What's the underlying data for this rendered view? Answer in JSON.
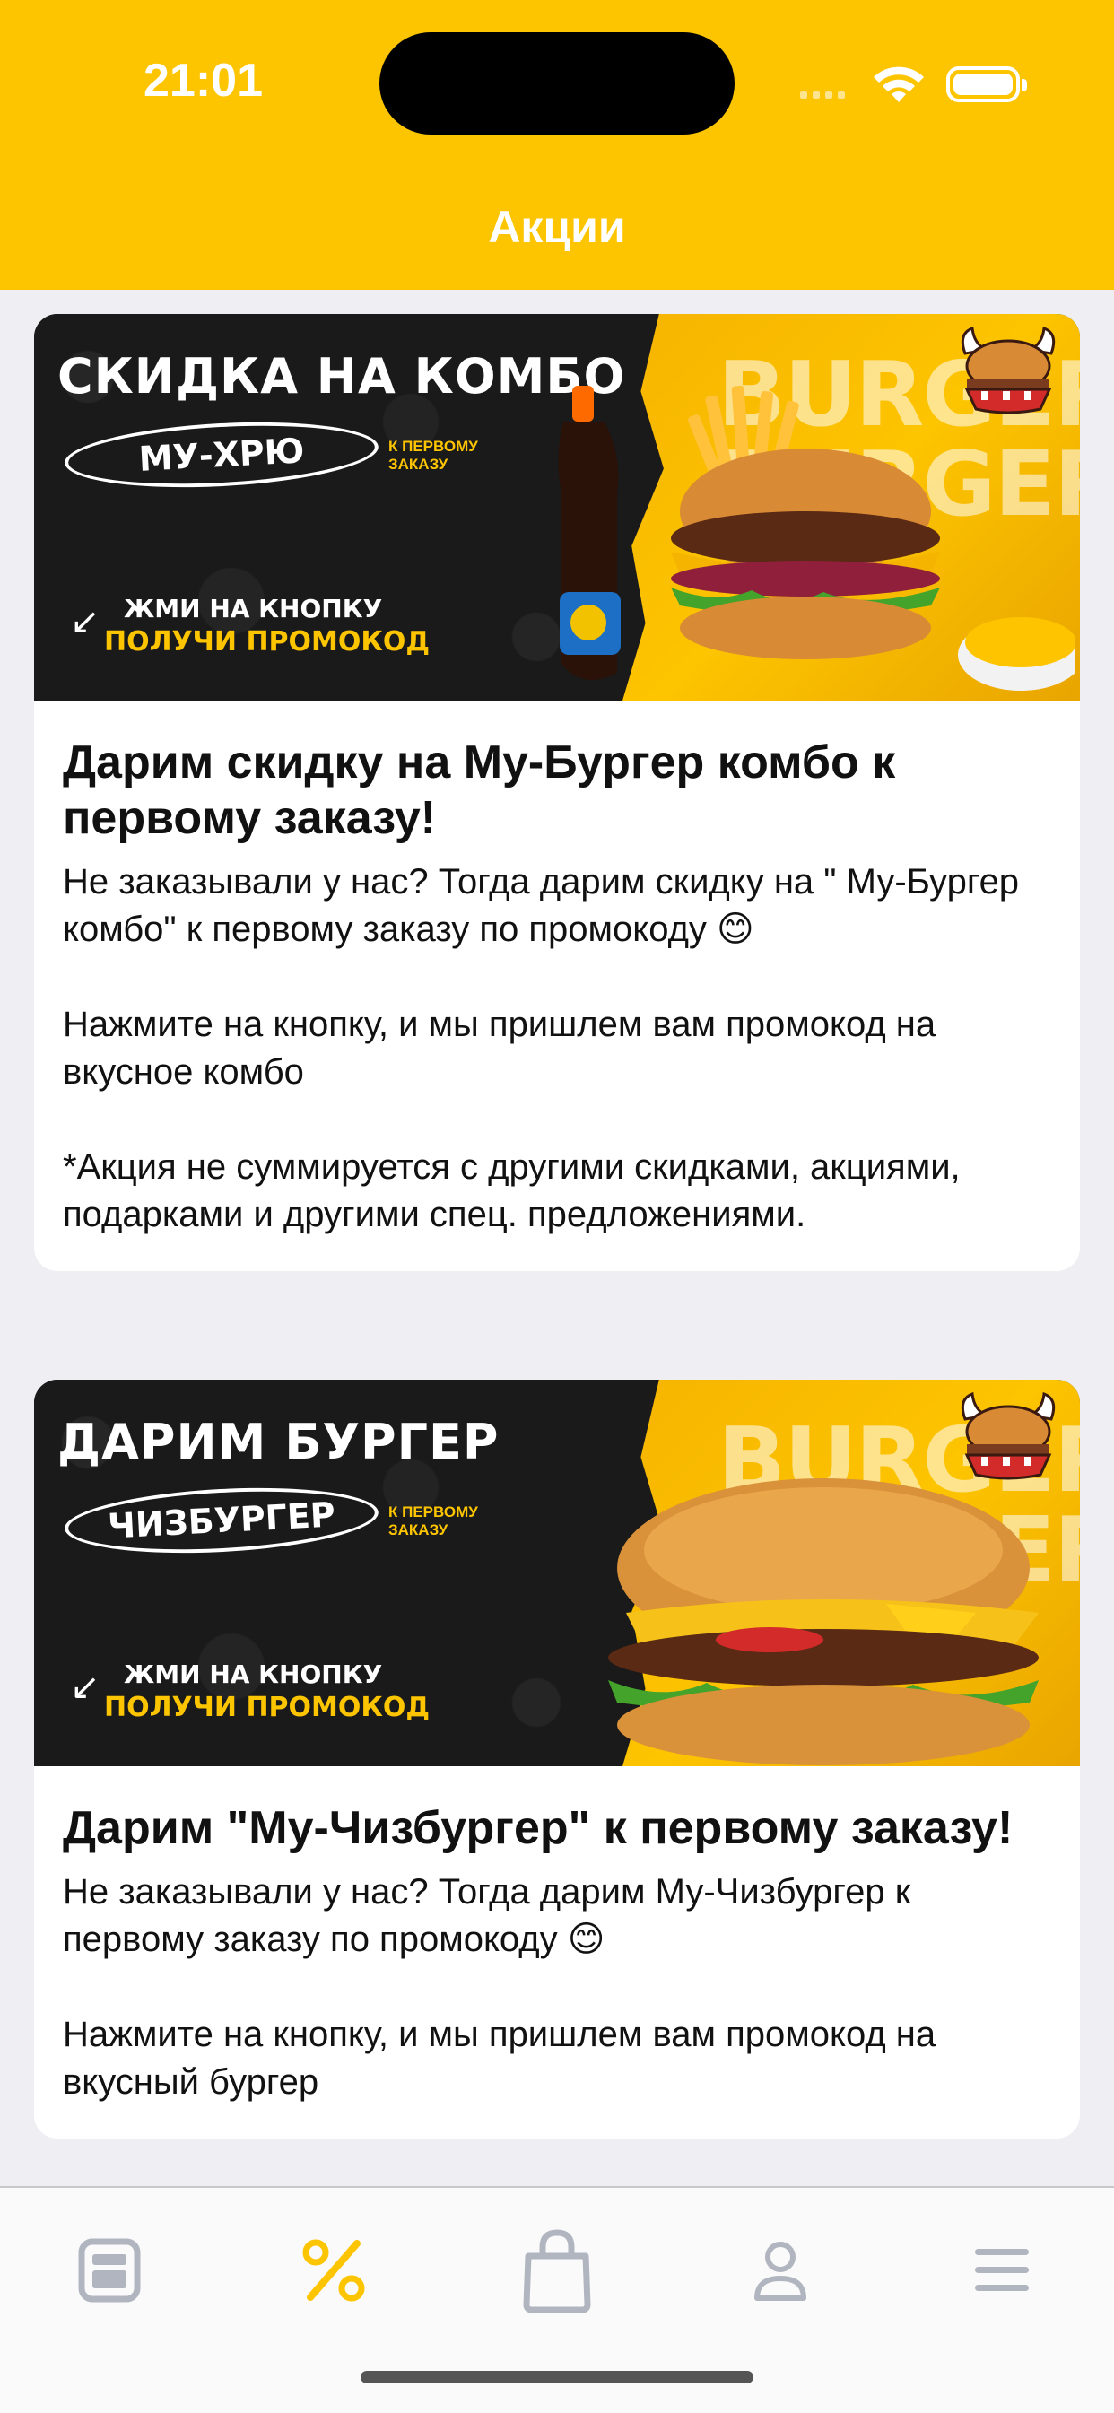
{
  "status_bar": {
    "time": "21:01"
  },
  "header": {
    "title": "Акции"
  },
  "colors": {
    "accent": "#fdc400",
    "tab_inactive": "#b0b5bf"
  },
  "promos": [
    {
      "banner": {
        "title": "СКИДКА НА КОМБО",
        "pill": "МУ-ХРЮ",
        "first_order": "К ПЕРВОМУ ЗАКАЗУ",
        "press": "ЖМИ НА КНОПКУ",
        "get_code": "ПОЛУЧИ ПРОМОКОД",
        "bg_word": "BURGER BURGER"
      },
      "title": "Дарим скидку на Му-Бургер комбо к первому заказу!",
      "text": "Не заказывали у нас? Тогда дарим скидку на \" Му-Бургер комбо\" к первому заказу по промокоду 😊\n\nНажмите на кнопку, и мы пришлем вам промокод на вкусное комбо\n\n*Акция не суммируется с другими скидками, акциями, подарками и другими спец. предложениями."
    },
    {
      "banner": {
        "title": "ДАРИМ БУРГЕР",
        "pill": "ЧИЗБУРГЕР",
        "first_order": "К ПЕРВОМУ ЗАКАЗУ",
        "press": "ЖМИ НА КНОПКУ",
        "get_code": "ПОЛУЧИ ПРОМОКОД",
        "bg_word": "BURGER BURGER"
      },
      "title": "Дарим \"Му-Чизбургер\" к первому заказу!",
      "text": "Не заказывали у нас? Тогда дарим Му-Чизбургер к первому заказу по промокоду 😊\n\nНажмите на кнопку, и мы пришлем вам промокод на вкусный бургер"
    }
  ],
  "tabbar": {
    "items": [
      {
        "icon": "menu-card-icon",
        "active": false
      },
      {
        "icon": "percent-icon",
        "active": true
      },
      {
        "icon": "shopping-bag-icon",
        "active": false
      },
      {
        "icon": "profile-icon",
        "active": false
      },
      {
        "icon": "hamburger-menu-icon",
        "active": false
      }
    ]
  }
}
